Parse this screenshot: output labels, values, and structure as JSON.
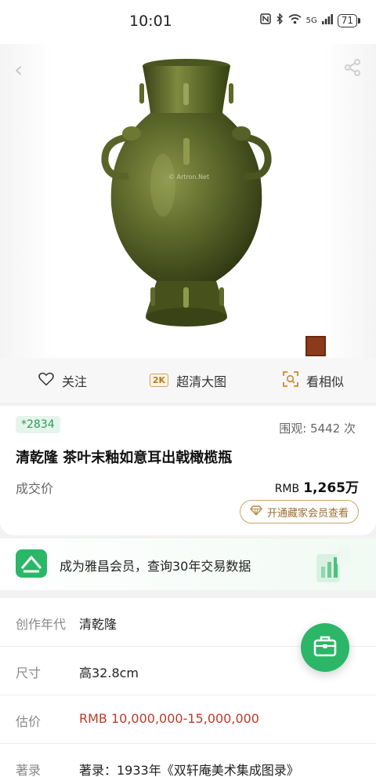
{
  "status_bar": {
    "time": "10:01",
    "network": "5G",
    "battery": "71",
    "icons": [
      "nfc-icon",
      "bluetooth-icon",
      "wifi-icon",
      "signal-icon",
      "battery-icon"
    ]
  },
  "hero": {
    "watermark": "© Artron.Net",
    "icons": [
      "back-icon",
      "share-icon"
    ]
  },
  "actions": {
    "follow_label": "关注",
    "hd_badge": "2K",
    "hd_label": "超清大图",
    "similar_label": "看相似"
  },
  "lot": {
    "badge": "*2834",
    "views": "围观:  5442  次",
    "title": "清乾隆 茶叶末釉如意耳出戟橄榄瓶",
    "price_label": "成交价",
    "currency": "RMB",
    "price": "1,265万",
    "vip_button": "开通藏家会员查看"
  },
  "promo": {
    "text": "成为雅昌会员，查询30年交易数据"
  },
  "details": [
    {
      "key": "创作年代",
      "value": "清乾隆"
    },
    {
      "key": "尺寸",
      "value": "高32.8cm"
    },
    {
      "key": "估价",
      "value": "RMB  10,000,000-15,000,000"
    },
    {
      "key": "著录",
      "value": "著录：1933年《双轩庵美术集成图录》"
    }
  ],
  "colors": {
    "accent_green": "#2cb668",
    "estimate_red": "#c0392b",
    "vase_olive": "#5f6a2c"
  }
}
